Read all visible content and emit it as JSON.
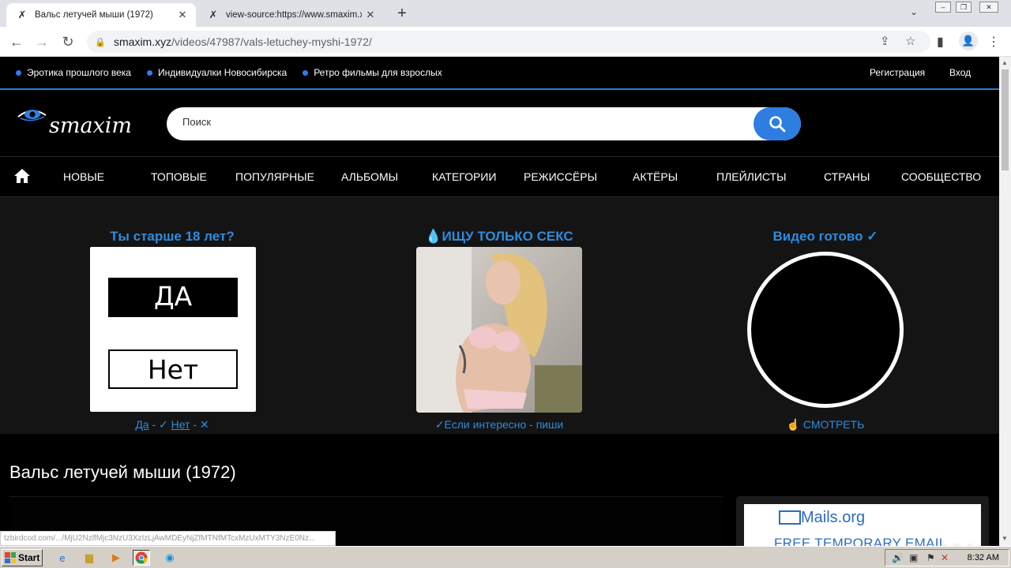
{
  "browser": {
    "tabs": [
      {
        "title": "Вальс летучей мыши (1972)",
        "active": true
      },
      {
        "title": "view-source:https://www.smaxim.x",
        "active": false
      }
    ],
    "url_host": "smaxim.xyz",
    "url_path": "/videos/47987/vals-letuchey-myshi-1972/"
  },
  "topbar": {
    "links": [
      "Эротика прошлого века",
      "Индивидуалки Новосибирска",
      "Ретро фильмы для взрослых"
    ],
    "register": "Регистрация",
    "login": "Вход"
  },
  "header": {
    "logo_text": "smaxim",
    "search_placeholder": "Поиск"
  },
  "nav": {
    "items": [
      "НОВЫЕ",
      "ТОПОВЫЕ",
      "ПОПУЛЯРНЫЕ",
      "АЛЬБОМЫ",
      "КАТЕГОРИИ",
      "РЕЖИССЁРЫ",
      "АКТЁРЫ",
      "ПЛЕЙЛИСТЫ",
      "СТРАНЫ",
      "СООБЩЕСТВО"
    ]
  },
  "promo": {
    "age": {
      "title": "Ты старше 18 лет?",
      "yes_button": "ДА",
      "no_button": "Нет",
      "footer_yes": "Да",
      "footer_sep1": " - ✓ ",
      "footer_no": "Нет",
      "footer_sep2": " - ✕"
    },
    "sex": {
      "title": "💧ИЩУ ТОЛЬКО СЕКС",
      "footer": "✓Если интересно - пиши"
    },
    "video": {
      "title": "Видео готово ✓",
      "footer": "☝ СМОТРЕТЬ"
    }
  },
  "video": {
    "title": "Вальс летучей мыши (1972)"
  },
  "ad": {
    "brand": "Mails.org",
    "line": "FREE TEMPORARY EMAIL"
  },
  "status_url": "tzbirdcod.com/.../MjU2NzlfMjc3NzU3XzIzLjAwMDEyNjZfMTNfMTcxMzUxMTY3NzE0Nz...",
  "watermark": "ANY.RUN",
  "taskbar": {
    "start": "Start",
    "clock": "8:32 AM"
  },
  "colors": {
    "accent": "#2d8cdf",
    "nav_border": "#2d7cd8",
    "search_button": "#2d7ee0"
  }
}
